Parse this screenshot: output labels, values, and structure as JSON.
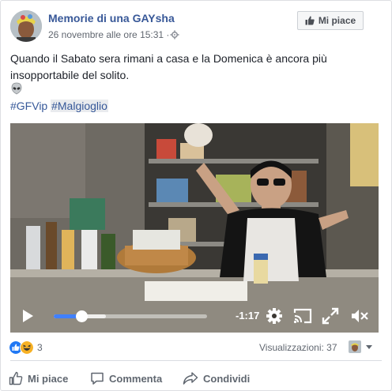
{
  "post": {
    "page_name": "Memorie di una GAYsha",
    "timestamp": "26 novembre alle ore 15:31 · ",
    "like_page_button": "Mi piace",
    "text": "Quando il Sabato sera rimani a casa e la Domenica è ancora più insopportabile del solito.",
    "emoji": "alien-emoji",
    "hashtags": [
      "#GFVip",
      "#Malgioglio"
    ]
  },
  "video": {
    "time_remaining": "-1:17",
    "progress": 0.18,
    "buffered": 0.34,
    "controls": [
      "play-icon",
      "settings-icon",
      "cast-icon",
      "fullscreen-icon",
      "mute-icon"
    ]
  },
  "stats": {
    "reaction_types": [
      "like",
      "haha"
    ],
    "reaction_count": "3",
    "views": "Visualizzazioni: 37"
  },
  "actions": {
    "like": "Mi piace",
    "comment": "Commenta",
    "share": "Condividi"
  },
  "colors": {
    "link": "#385898",
    "accent": "#4080ff",
    "muted": "#616770",
    "like_blue": "#2078f4",
    "haha_yellow": "#f7b125"
  }
}
